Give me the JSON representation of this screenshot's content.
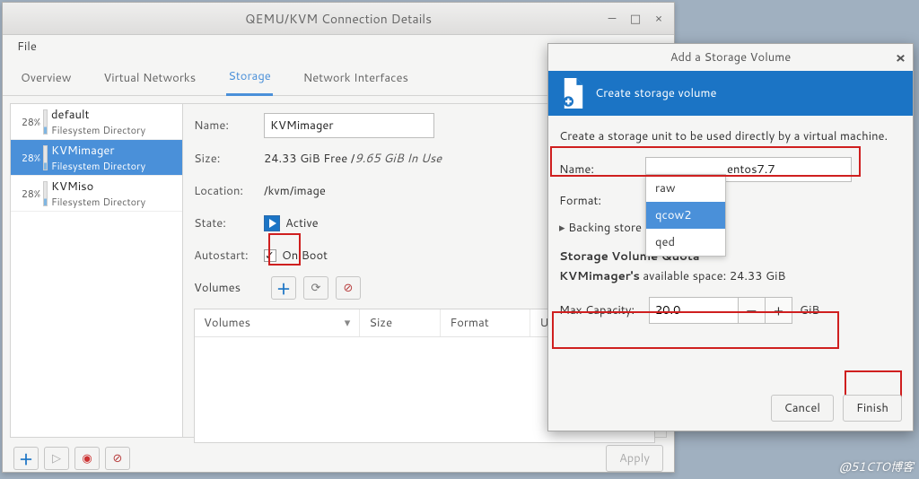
{
  "main_window": {
    "title": "QEMU/KVM Connection Details",
    "menu": {
      "file": "File"
    },
    "tabs": {
      "overview": "Overview",
      "virtual_networks": "Virtual Networks",
      "storage": "Storage",
      "network_interfaces": "Network Interfaces",
      "active": "storage"
    },
    "pools": [
      {
        "pct": "28%",
        "name": "default",
        "sub": "Filesystem Directory",
        "selected": false
      },
      {
        "pct": "28%",
        "name": "KVMimager",
        "sub": "Filesystem Directory",
        "selected": true
      },
      {
        "pct": "28%",
        "name": "KVMiso",
        "sub": "Filesystem Directory",
        "selected": false
      }
    ],
    "details": {
      "name_label": "Name:",
      "name_value": "KVMimager",
      "size_label": "Size:",
      "size_value_free": "24.33 GiB Free / ",
      "size_value_used": "9.65 GiB In Use",
      "location_label": "Location:",
      "location_value": "/kvm/image",
      "state_label": "State:",
      "state_value": "Active",
      "autostart_label": "Autostart:",
      "autostart_value": "On Boot",
      "volumes_label": "Volumes",
      "table_headers": {
        "c1": "Volumes",
        "c2": "Size",
        "c3": "Format",
        "c4": "Used By"
      },
      "table_rows": []
    },
    "footer": {
      "apply": "Apply"
    }
  },
  "dialog": {
    "title": "Add a Storage Volume",
    "banner": "Create storage volume",
    "desc": "Create a storage unit to be used directly by a virtual machine.",
    "name_label": "Name:",
    "name_value": "entos7.7",
    "format_label": "Format:",
    "format_options": [
      "raw",
      "qcow2",
      "qed"
    ],
    "format_selected": "qcow2",
    "backing_label": "Backing store",
    "quota_heading": "Storage Volume Quota",
    "quota_text_prefix": "KVMimager's",
    "quota_text_rest": " available space: 24.33 GiB",
    "capacity_label": "Max Capacity:",
    "capacity_value": "20.0",
    "capacity_unit": "GiB",
    "cancel": "Cancel",
    "finish": "Finish"
  },
  "watermark": "@51CTO博客"
}
